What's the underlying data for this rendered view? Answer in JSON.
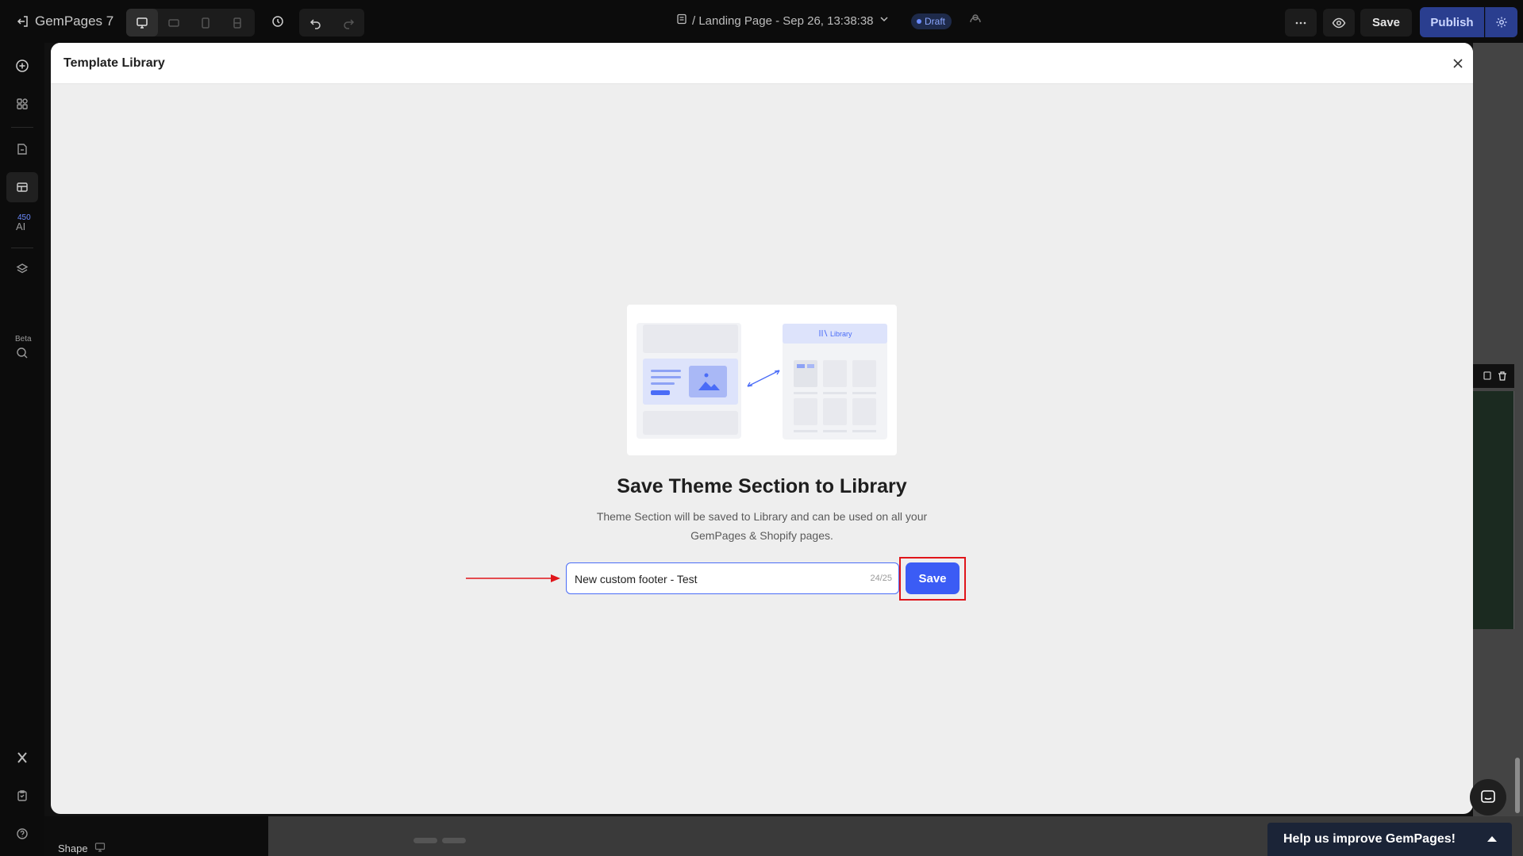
{
  "topbar": {
    "app_name": "GemPages 7",
    "page_title": "/ Landing Page - Sep 26, 13:38:38",
    "draft_label": "Draft",
    "save_label": "Save",
    "publish_label": "Publish"
  },
  "rail": {
    "badge_count": "450",
    "beta_label": "Beta"
  },
  "background": {
    "shape_label": "Shape"
  },
  "modal": {
    "title": "Template Library",
    "illustration_library_label": "Library",
    "heading": "Save Theme Section to Library",
    "description": "Theme Section will be saved to Library and can be used on all your GemPages & Shopify pages.",
    "name_input_value": "New custom footer - Test",
    "name_counter": "24/25",
    "save_label": "Save"
  },
  "help_banner": {
    "label": "Help us improve GemPages!"
  },
  "colors": {
    "accent": "#3b5cf5",
    "highlight": "#e0151a",
    "modal_bg": "#eeeeee"
  }
}
